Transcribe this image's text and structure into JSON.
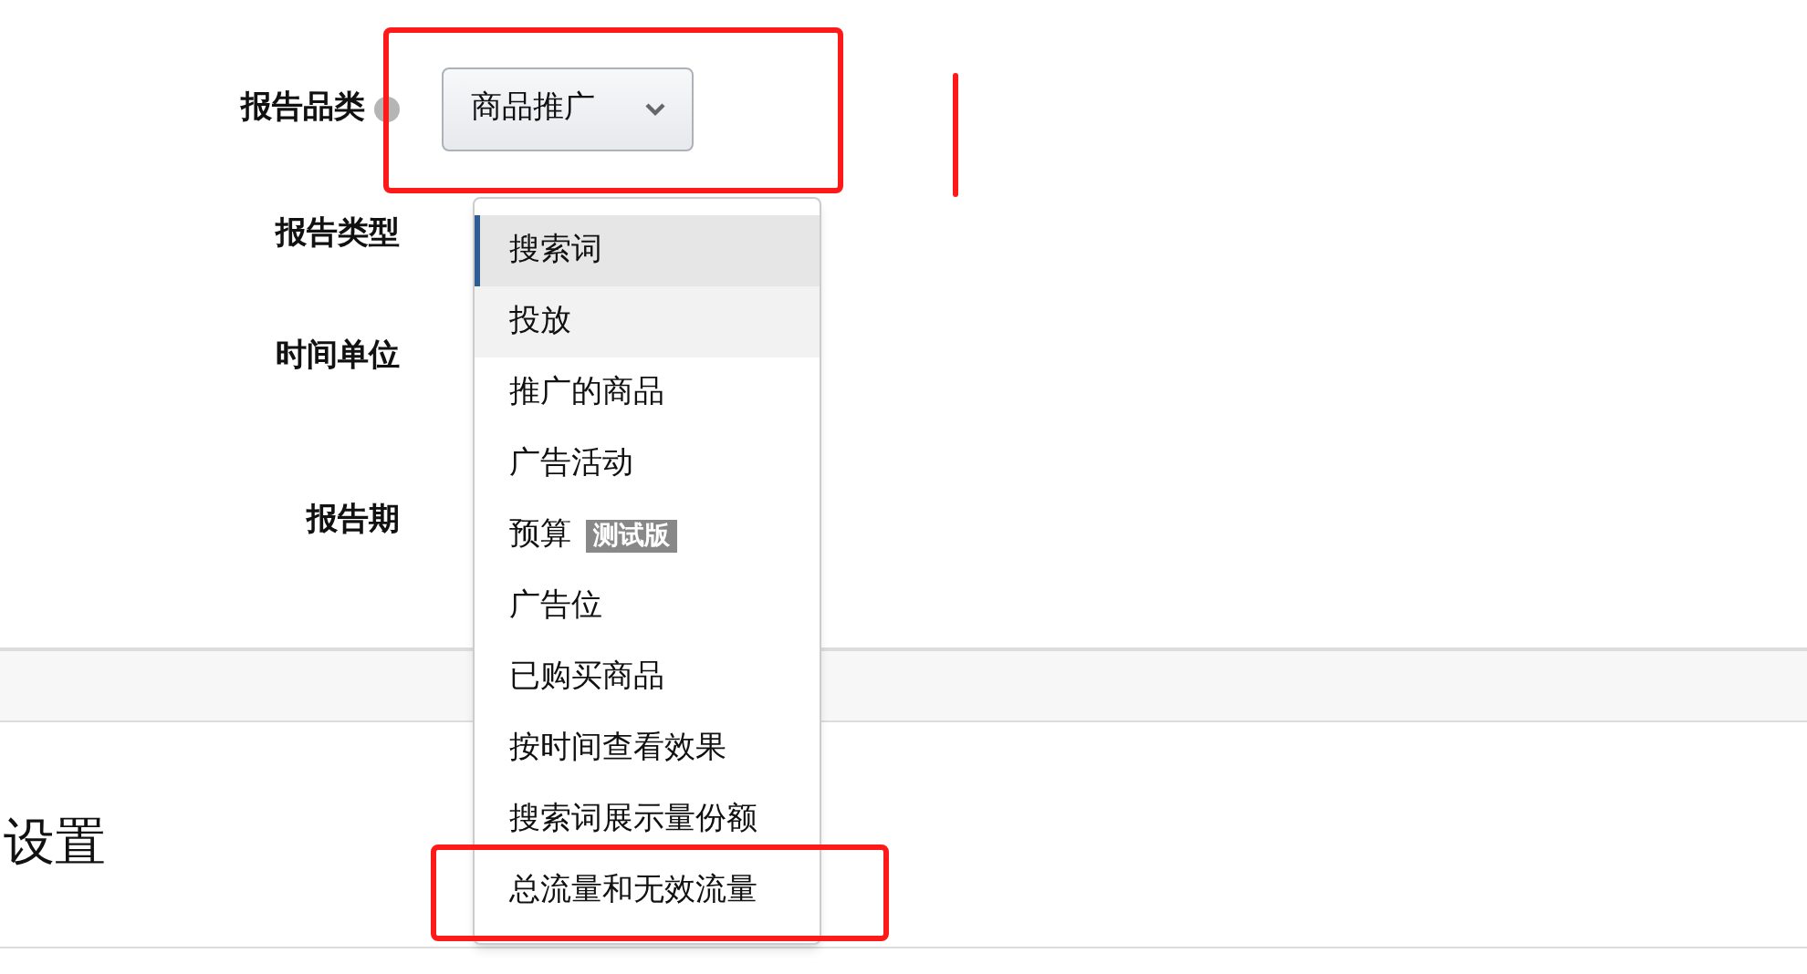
{
  "form": {
    "fields": [
      {
        "label": "报告品类",
        "info": true
      },
      {
        "label": "报告类型",
        "info": false
      },
      {
        "label": "时间单位",
        "info": false
      },
      {
        "label": "报告期",
        "info": false
      }
    ]
  },
  "category_select": {
    "value": "商品推广"
  },
  "menu": {
    "items": [
      {
        "label": "搜索词",
        "selected": true,
        "hovered": false
      },
      {
        "label": "投放",
        "selected": false,
        "hovered": true
      },
      {
        "label": "推广的商品",
        "selected": false,
        "hovered": false
      },
      {
        "label": "广告活动",
        "selected": false,
        "hovered": false
      },
      {
        "label": "预算",
        "badge": "测试版",
        "selected": false,
        "hovered": false
      },
      {
        "label": "广告位",
        "selected": false,
        "hovered": false
      },
      {
        "label": "已购买商品",
        "selected": false,
        "hovered": false
      },
      {
        "label": "按时间查看效果",
        "selected": false,
        "hovered": false
      },
      {
        "label": "搜索词展示量份额",
        "selected": false,
        "hovered": false
      },
      {
        "label": "总流量和无效流量",
        "selected": false,
        "hovered": false
      }
    ]
  },
  "section": {
    "title": "设置"
  }
}
